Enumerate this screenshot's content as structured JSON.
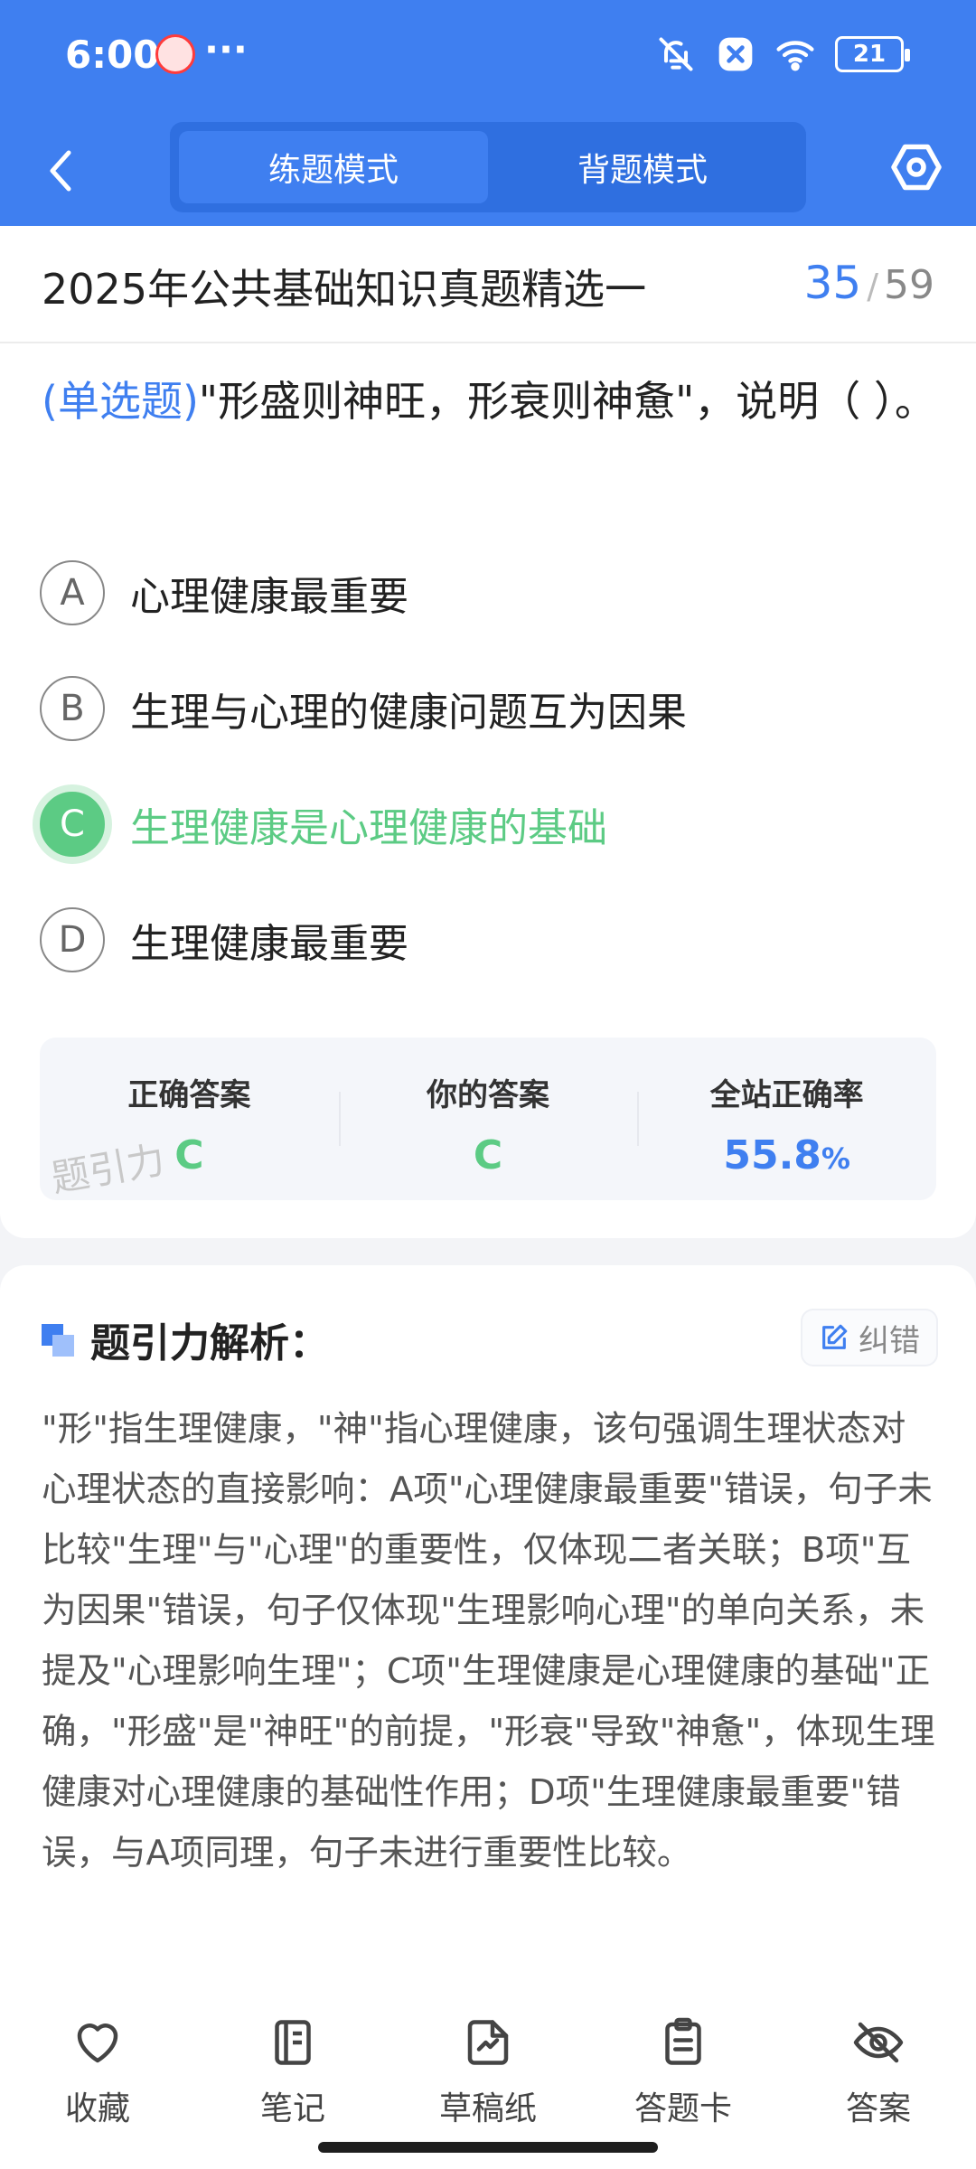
{
  "status_bar": {
    "time": "6:00",
    "more": "···",
    "battery": "21"
  },
  "nav": {
    "tabs": [
      {
        "label": "练题模式",
        "active": true
      },
      {
        "label": "背题模式",
        "active": false
      }
    ]
  },
  "question": {
    "set_title": "2025年公共基础知识真题精选一",
    "current": "35",
    "separator": "/",
    "total": "59",
    "type": "(单选题)",
    "stem": "\"形盛则神旺，形衰则神惫\"，说明（ ）。",
    "options": [
      {
        "letter": "A",
        "text": "心理健康最重要",
        "state": "normal"
      },
      {
        "letter": "B",
        "text": "生理与心理的健康问题互为因果",
        "state": "normal"
      },
      {
        "letter": "C",
        "text": "生理健康是心理健康的基础",
        "state": "correct"
      },
      {
        "letter": "D",
        "text": "生理健康最重要",
        "state": "normal"
      }
    ]
  },
  "answers": {
    "correct_label": "正确答案",
    "correct_value": "C",
    "yours_label": "你的答案",
    "yours_value": "C",
    "rate_label": "全站正确率",
    "rate_value": "55.8",
    "rate_unit": "%",
    "watermark": "题引力"
  },
  "analysis": {
    "title": "题引力解析：",
    "fix_label": "纠错",
    "text": "\"形\"指生理健康，\"神\"指心理健康，该句强调生理状态对心理状态的直接影响：A项\"心理健康最重要\"错误，句子未比较\"生理\"与\"心理\"的重要性，仅体现二者关联；B项\"互为因果\"错误，句子仅体现\"生理影响心理\"的单向关系，未提及\"心理影响生理\"；C项\"生理健康是心理健康的基础\"正确，\"形盛\"是\"神旺\"的前提，\"形衰\"导致\"神惫\"，体现生理健康对心理健康的基础性作用；D项\"生理健康最重要\"错误，与A项同理，句子未进行重要性比较。"
  },
  "bottom_bar": {
    "items": [
      {
        "label": "收藏",
        "icon": "heart-icon"
      },
      {
        "label": "笔记",
        "icon": "notebook-icon"
      },
      {
        "label": "草稿纸",
        "icon": "draft-icon"
      },
      {
        "label": "答题卡",
        "icon": "answer-card-icon"
      },
      {
        "label": "答案",
        "icon": "eye-off-icon"
      }
    ]
  },
  "colors": {
    "brand_blue": "#3f7ff0",
    "correct_green": "#5ccb84"
  }
}
